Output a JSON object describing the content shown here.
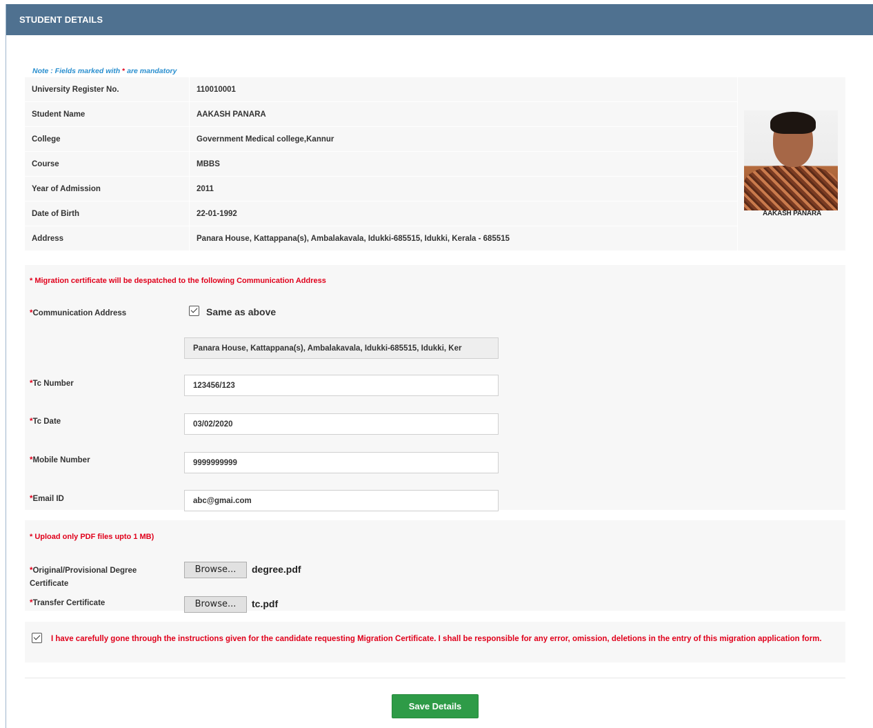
{
  "header": {
    "title": "STUDENT DETAILS"
  },
  "note": {
    "prefix": "Note : Fields marked with ",
    "star": "*",
    "suffix": " are mandatory"
  },
  "details": {
    "rows": [
      {
        "label": "University Register No.",
        "value": "110010001"
      },
      {
        "label": "Student Name",
        "value": "AAKASH PANARA"
      },
      {
        "label": "College",
        "value": "Government Medical college,Kannur"
      },
      {
        "label": "Course",
        "value": "MBBS"
      },
      {
        "label": "Year of Admission",
        "value": "2011"
      },
      {
        "label": "Date of Birth",
        "value": "22-01-1992"
      },
      {
        "label": "Address",
        "value": "Panara House, Kattappana(s), Ambalakavala, Idukki-685515, Idukki, Kerala - 685515"
      }
    ],
    "photo_caption": "AAKASH PANARA"
  },
  "communication": {
    "note": "* Migration certificate will be despatched to the following Communication Address",
    "address_label": "Communication Address",
    "same_as_above_label": "Same as above",
    "same_as_above_checked": true,
    "address_value": "Panara House, Kattappana(s), Ambalakavala, Idukki-685515, Idukki, Ker",
    "tc_number_label": "Tc Number",
    "tc_number_value": "123456/123",
    "tc_date_label": "Tc Date",
    "tc_date_value": "03/02/2020",
    "mobile_label": "Mobile Number",
    "mobile_value": "9999999999",
    "email_label": "Email ID",
    "email_value": "abc@gmai.com",
    "star": "*"
  },
  "upload": {
    "note": "* Upload only PDF files upto 1 MB)",
    "degree_label": "Original/Provisional Degree Certificate",
    "degree_browse": "Browse...",
    "degree_file": "degree.pdf",
    "tc_label": "Transfer Certificate",
    "tc_browse": "Browse...",
    "tc_file": "tc.pdf"
  },
  "declaration": {
    "checked": true,
    "text": "I have carefully gone through the instructions given for the candidate requesting Migration Certificate. I shall be responsible for any error, omission, deletions in the entry of this migration application form."
  },
  "actions": {
    "save_label": "Save Details"
  },
  "colors": {
    "header": "#4f7190",
    "mandatory": "#e0001b",
    "note": "#2a8fcf",
    "save": "#2e9b47"
  }
}
